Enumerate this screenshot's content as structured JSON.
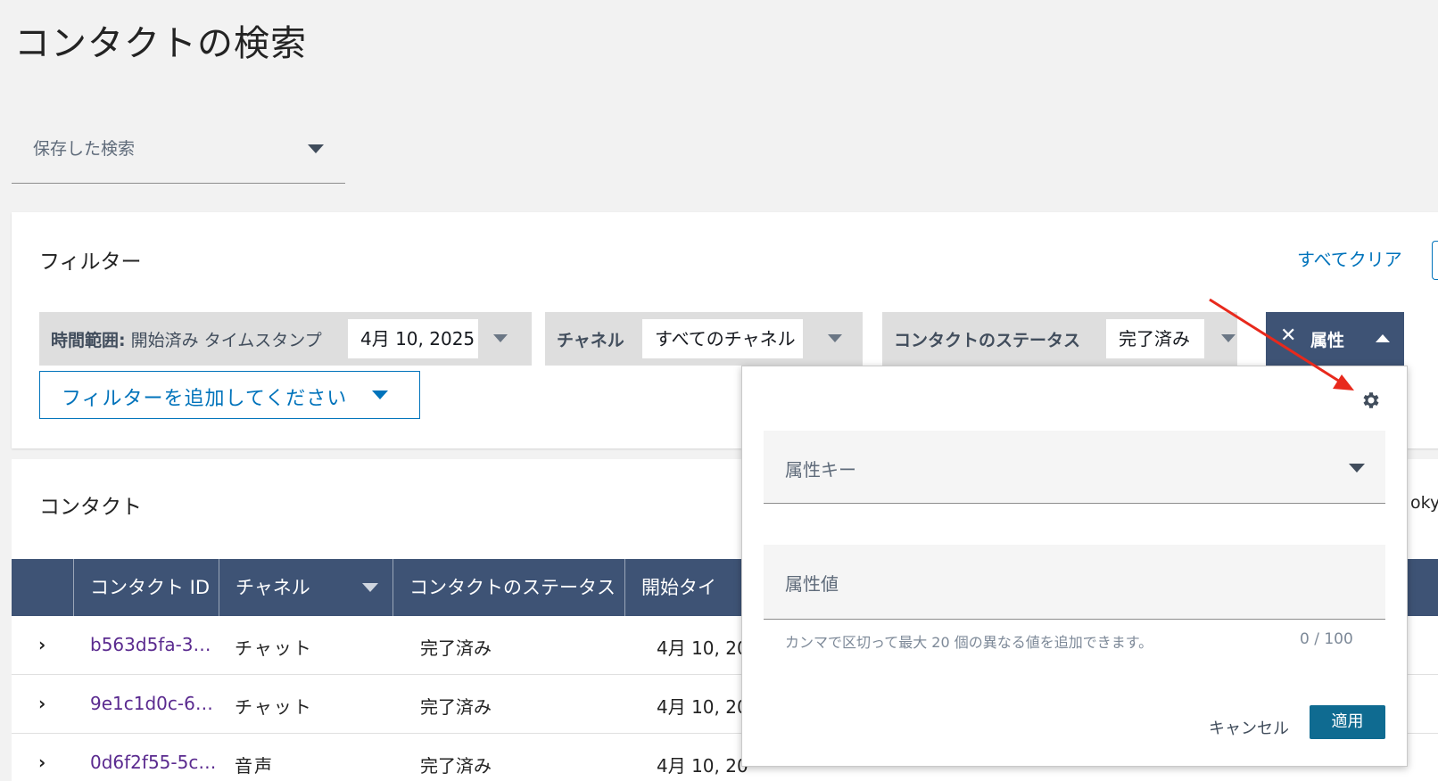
{
  "page": {
    "title": "コンタクトの検索"
  },
  "saved_search": {
    "label": "保存した検索"
  },
  "filters": {
    "title": "フィルター",
    "clear_all": "すべてクリア",
    "time_range": {
      "label_bold": "時間範囲:",
      "label_rest": " 開始済み タイムスタンプ",
      "value": "4月 10, 2025"
    },
    "channel": {
      "label": "チャネル",
      "value": "すべてのチャネル"
    },
    "status": {
      "label": "コンタクトのステータス",
      "value": "完了済み"
    },
    "attribute": {
      "close": "✕",
      "label": "属性"
    },
    "add_filter": "フィルターを追加してください"
  },
  "contacts": {
    "title": "コンタクト",
    "timezone_fragment": "okyo",
    "columns": [
      "コンタクト ID",
      "チャネル",
      "コンタクトのステータス",
      "開始タイ"
    ],
    "rows": [
      {
        "expand": "›",
        "id": "b563d5fa-3…",
        "channel": "チャット",
        "status": "完了済み",
        "date": "4月 10, 20"
      },
      {
        "expand": "›",
        "id": "9e1c1d0c-6…",
        "channel": "チャット",
        "status": "完了済み",
        "date": "4月 10, 20"
      },
      {
        "expand": "›",
        "id": "0d6f2f55-5c…",
        "channel": "音声",
        "status": "完了済み",
        "date": "4月 10, 20"
      }
    ]
  },
  "attribute_popover": {
    "settings_icon": "gear-icon",
    "key_label": "属性キー",
    "value_label": "属性値",
    "hint": "カンマで区切って最大 20 個の異なる値を追加できます。",
    "counter": "0 / 100",
    "cancel": "キャンセル",
    "apply": "適用"
  },
  "colors": {
    "header_bg": "#3e5375",
    "link": "#0073bb",
    "contact_id": "#5a2a8f",
    "apply_bg": "#0f6b91",
    "annotation_arrow": "#e8291c"
  }
}
